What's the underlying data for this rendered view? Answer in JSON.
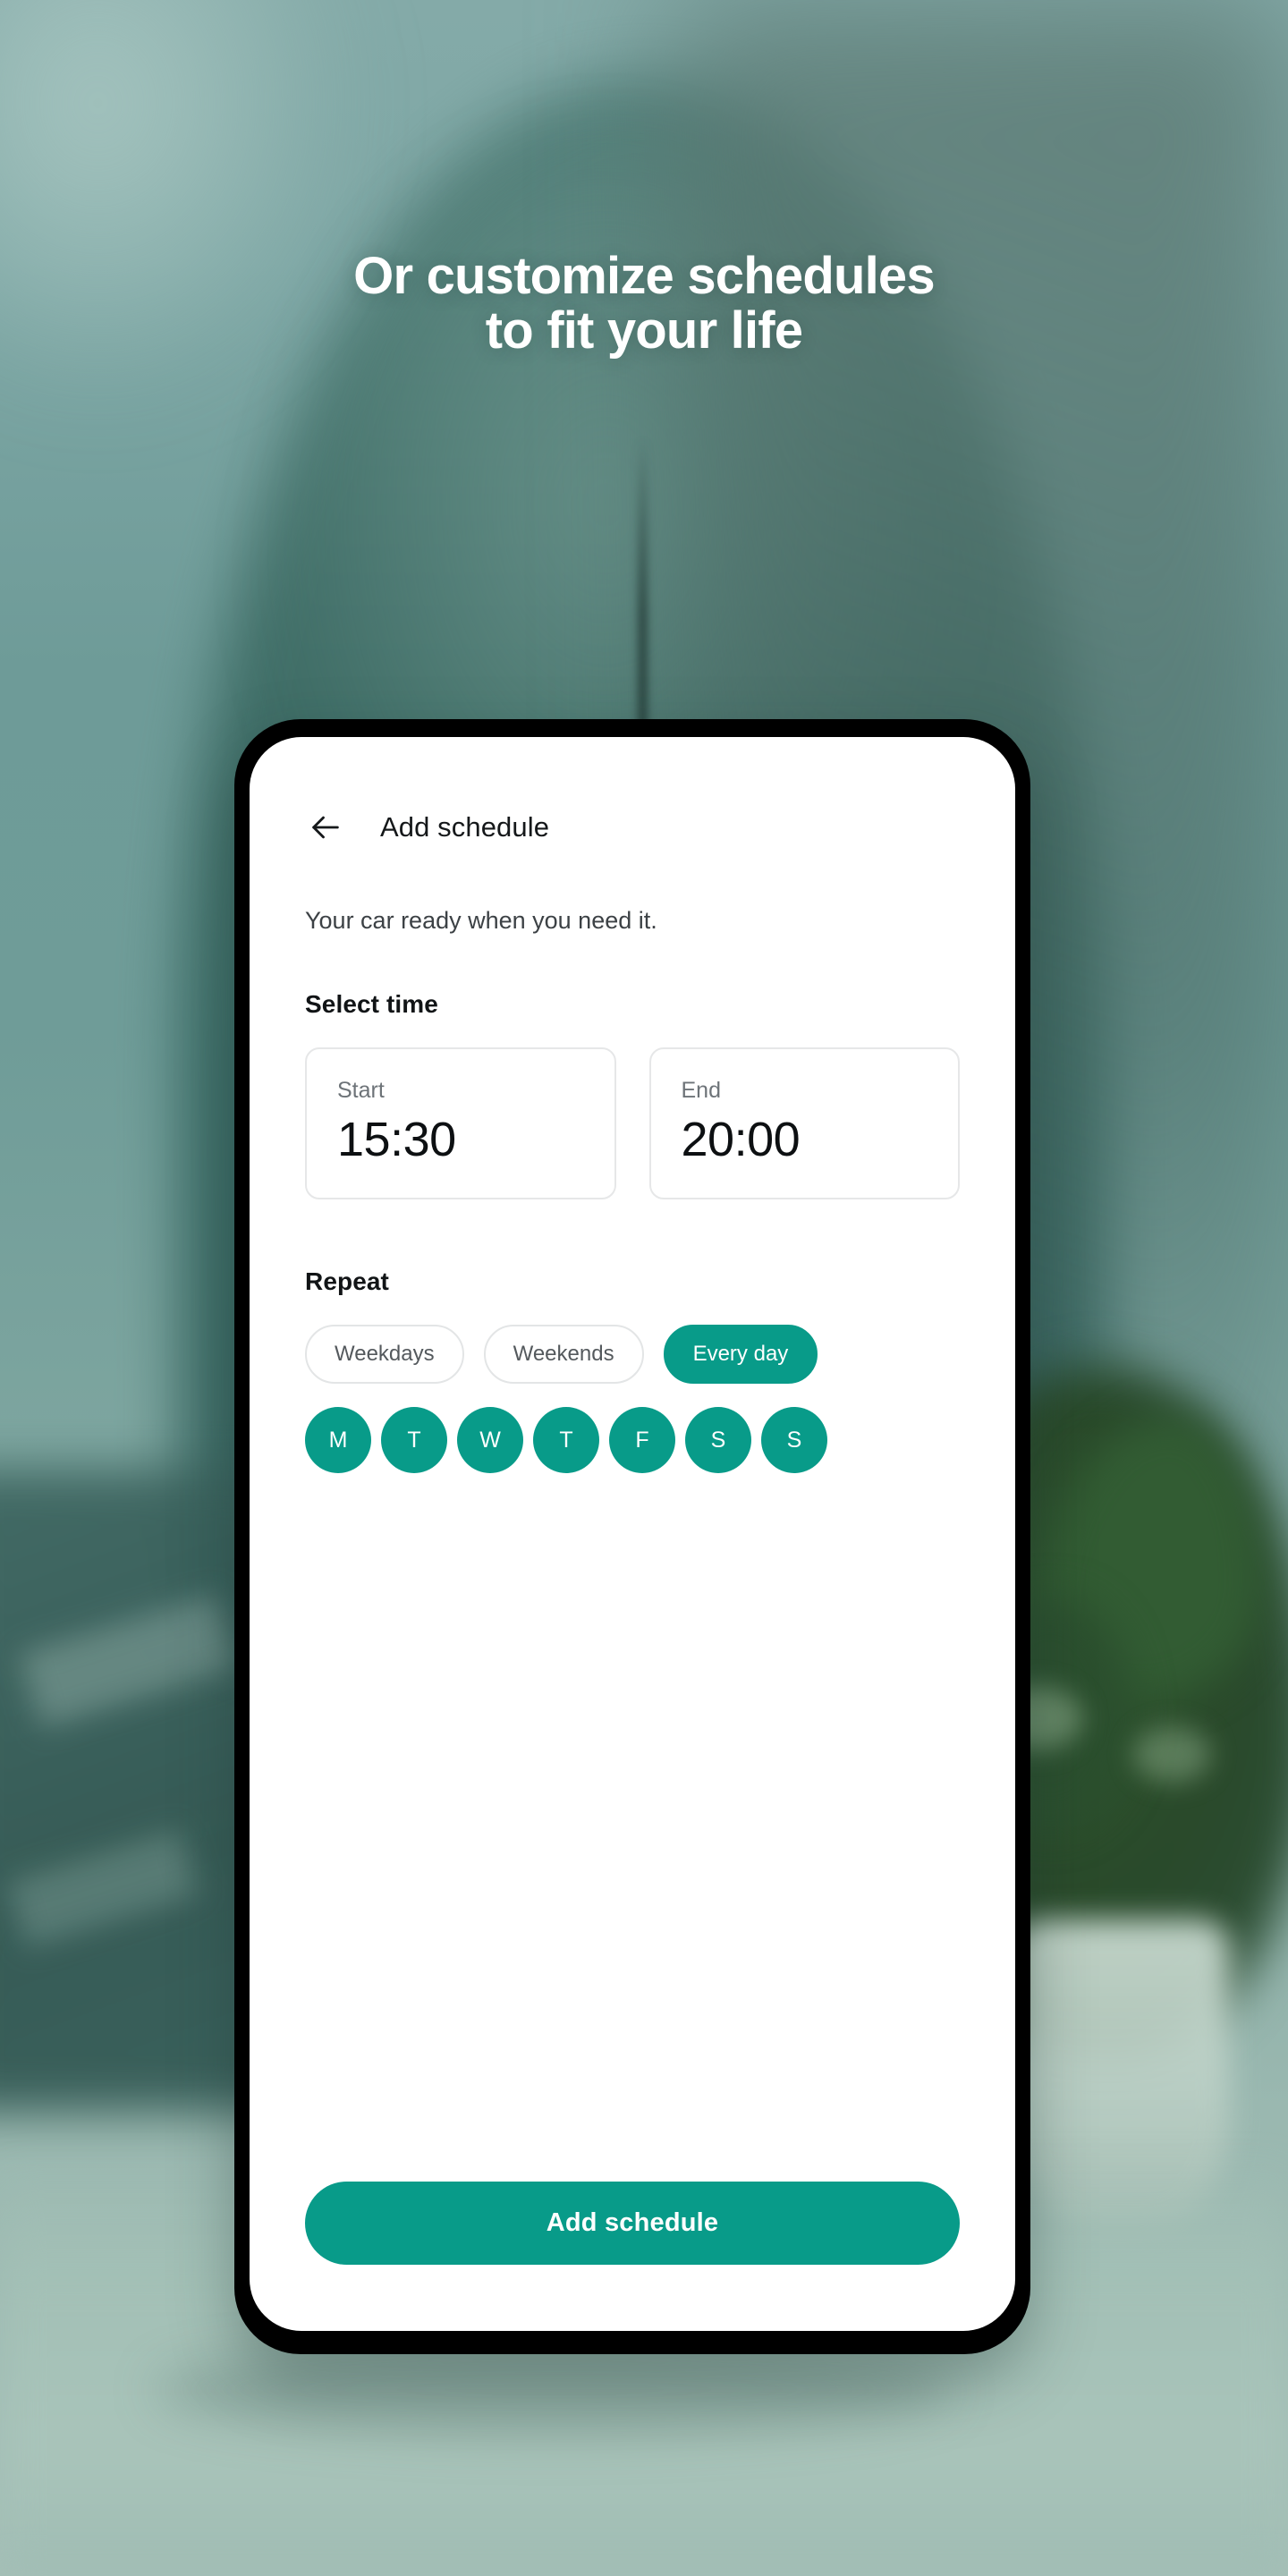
{
  "theme": {
    "accent": "#089b89",
    "headline_color": "#ffffff",
    "screen_bg": "#ffffff",
    "phone_frame": "#000000",
    "card_border": "#e6e7e8",
    "muted_text": "#6d7378"
  },
  "headline": {
    "text": "Or customize schedules\nto fit your life"
  },
  "phone": {
    "app_bar": {
      "back_icon": "arrow-left-icon",
      "title": "Add schedule"
    },
    "subtitle": "Your car ready when you need it.",
    "select_time": {
      "label": "Select time",
      "cards": [
        {
          "label": "Start",
          "value": "15:30"
        },
        {
          "label": "End",
          "value": "20:00"
        }
      ]
    },
    "repeat": {
      "label": "Repeat",
      "chips": [
        {
          "label": "Weekdays",
          "selected": false
        },
        {
          "label": "Weekends",
          "selected": false
        },
        {
          "label": "Every day",
          "selected": true
        }
      ],
      "days": [
        {
          "label": "M",
          "selected": true
        },
        {
          "label": "T",
          "selected": true
        },
        {
          "label": "W",
          "selected": true
        },
        {
          "label": "T",
          "selected": true
        },
        {
          "label": "F",
          "selected": true
        },
        {
          "label": "S",
          "selected": true
        },
        {
          "label": "S",
          "selected": true
        }
      ]
    },
    "cta": {
      "label": "Add schedule"
    }
  }
}
